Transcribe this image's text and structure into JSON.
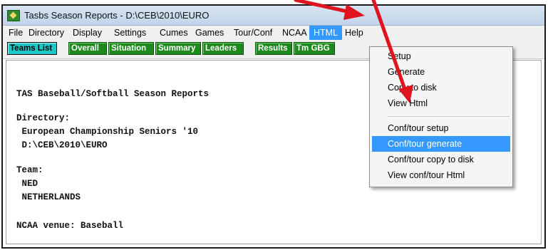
{
  "window": {
    "title": "Tasbs Season Reports - D:\\CEB\\2010\\EURO"
  },
  "menubar": {
    "items": [
      "File",
      "Directory",
      "Display",
      "Settings",
      "Cumes",
      "Games",
      "Tour/Conf",
      "NCAA",
      "HTML",
      "Help"
    ],
    "active": "HTML"
  },
  "toolbar": {
    "buttons": [
      "Teams List",
      "Overall",
      "Situation",
      "Summary",
      "Leaders",
      "Results",
      "Tm GBG"
    ]
  },
  "content": {
    "lines": [
      "TAS Baseball/Softball Season Reports",
      "Directory:",
      " European Championship Seniors '10",
      " D:\\CEB\\2010\\EURO",
      "Team:",
      " NED",
      " NETHERLANDS",
      "NCAA venue: Baseball"
    ]
  },
  "html_menu": {
    "items": [
      "Setup",
      "Generate",
      "Copy to disk",
      "View Html",
      "Conf/tour setup",
      "Conf/tour generate",
      "Conf/tour copy to disk",
      "View conf/tour Html"
    ],
    "selected": "Conf/tour generate"
  },
  "colors": {
    "accent": "#3399ff",
    "toolbar_button": "#1e8a1e",
    "teams_button": "#1ec8c8",
    "annotation_arrow": "#e0141e"
  }
}
